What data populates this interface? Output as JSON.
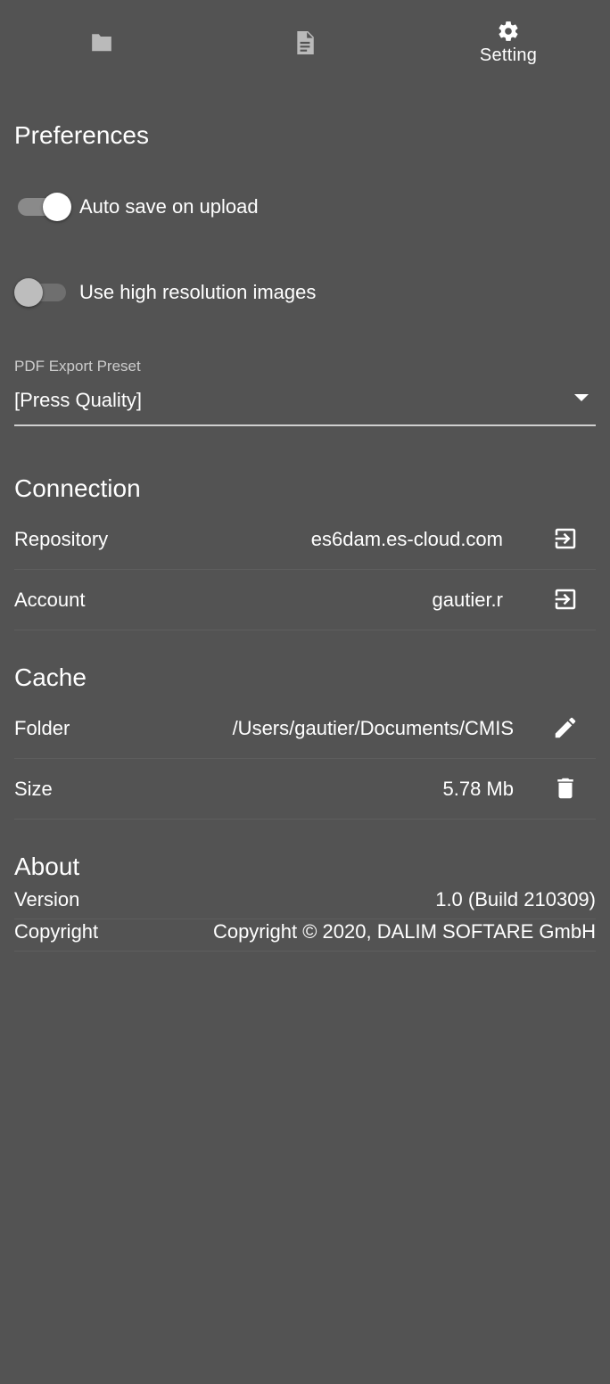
{
  "tabs": [
    {
      "icon": "folder-icon",
      "label": ""
    },
    {
      "icon": "document-icon",
      "label": ""
    },
    {
      "icon": "gear-icon",
      "label": "Setting"
    }
  ],
  "preferences": {
    "title": "Preferences",
    "auto_save": {
      "label": "Auto save on upload",
      "checked": true
    },
    "high_res": {
      "label": "Use high resolution images",
      "checked": false
    },
    "pdf_preset": {
      "label": "PDF Export Preset",
      "value": "[Press Quality]"
    }
  },
  "connection": {
    "title": "Connection",
    "repository": {
      "label": "Repository",
      "value": "es6dam.es-cloud.com"
    },
    "account": {
      "label": "Account",
      "value": "gautier.r"
    }
  },
  "cache": {
    "title": "Cache",
    "folder": {
      "label": "Folder",
      "value": "/Users/gautier/Documents/CMIS"
    },
    "size": {
      "label": "Size",
      "value": "5.78 Mb"
    }
  },
  "about": {
    "title": "About",
    "version": {
      "label": "Version",
      "value": "1.0 (Build 210309)"
    },
    "copyright": {
      "label": "Copyright",
      "value": "Copyright © 2020, DALIM SOFTARE GmbH"
    }
  },
  "colors": {
    "background": "#535353",
    "text": "#ffffff",
    "divider": "#5e5e5e"
  }
}
